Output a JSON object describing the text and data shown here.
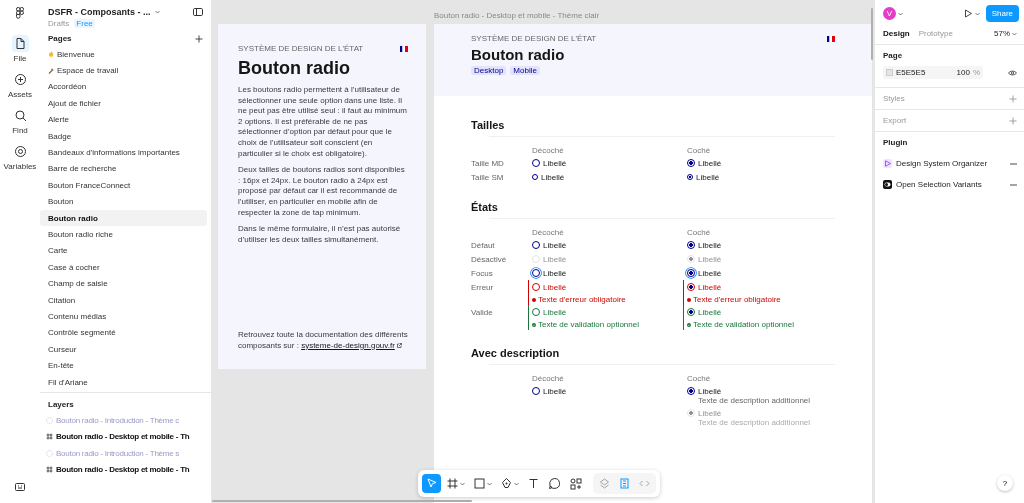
{
  "rail": {
    "items": [
      {
        "label": "File",
        "kind": "file",
        "selected": true
      },
      {
        "label": "Assets",
        "kind": "assets",
        "selected": false
      },
      {
        "label": "Find",
        "kind": "find",
        "selected": false
      },
      {
        "label": "Variables",
        "kind": "variables",
        "selected": false
      }
    ]
  },
  "file": {
    "name": "DSFR - Composants - ...",
    "location": "Drafts",
    "plan": "Free"
  },
  "pages": {
    "title": "Pages",
    "items": [
      {
        "label": "Bienvenue",
        "kind": "hand",
        "selected": false
      },
      {
        "label": "Espace de travail",
        "kind": "hammer",
        "selected": false
      },
      {
        "label": "Accordéon",
        "kind": "plain",
        "selected": false
      },
      {
        "label": "Ajout de fichier",
        "kind": "plain",
        "selected": false
      },
      {
        "label": "Alerte",
        "kind": "plain",
        "selected": false
      },
      {
        "label": "Badge",
        "kind": "plain",
        "selected": false
      },
      {
        "label": "Bandeaux d'informations importantes",
        "kind": "plain",
        "selected": false
      },
      {
        "label": "Barre de recherche",
        "kind": "plain",
        "selected": false
      },
      {
        "label": "Bouton FranceConnect",
        "kind": "plain",
        "selected": false
      },
      {
        "label": "Bouton",
        "kind": "plain",
        "selected": false
      },
      {
        "label": "Bouton radio",
        "kind": "plain",
        "selected": true
      },
      {
        "label": "Bouton radio riche",
        "kind": "plain",
        "selected": false
      },
      {
        "label": "Carte",
        "kind": "plain",
        "selected": false
      },
      {
        "label": "Case à cocher",
        "kind": "plain",
        "selected": false
      },
      {
        "label": "Champ de saisie",
        "kind": "plain",
        "selected": false
      },
      {
        "label": "Citation",
        "kind": "plain",
        "selected": false
      },
      {
        "label": "Contenu médias",
        "kind": "plain",
        "selected": false
      },
      {
        "label": "Contrôle segmenté",
        "kind": "plain",
        "selected": false
      },
      {
        "label": "Curseur",
        "kind": "plain",
        "selected": false
      },
      {
        "label": "En-tête",
        "kind": "plain",
        "selected": false
      },
      {
        "label": "Fil d'Ariane",
        "kind": "plain",
        "selected": false
      }
    ]
  },
  "layers": {
    "title": "Layers",
    "items": [
      {
        "label": "Bouton radio - Introduction - Thème c",
        "kind": "section"
      },
      {
        "label": "Bouton radio - Desktop et mobile - Th",
        "kind": "frame"
      },
      {
        "label": "Bouton radio - Introduction - Thème s",
        "kind": "section"
      },
      {
        "label": "Bouton radio - Desktop et mobile - Th",
        "kind": "frame"
      }
    ]
  },
  "canvas": {
    "intro_frame": {
      "eyebrow": "SYSTÈME DE DESIGN DE L'ÉTAT",
      "heading": "Bouton radio",
      "paragraphs": [
        "Les boutons radio permettent à l’utilisateur de sélectionner une seule option dans une liste. Il ne peut pas être utilisé seul : il faut au minimum 2 options. Il est préférable de ne pas sélectionner d’option par défaut pour que le choix de l’utilisateur soit conscient (en particulier si le choix est obligatoire).",
        "Deux tailles de boutons radios sont disponibles : 16px et 24px. Le bouton radio à 24px est proposé par défaut car il est recommandé de l’utiliser, en particulier en mobile afin de respecter la zone de tap minimum.",
        "Dans le même formulaire, il n’est pas autorisé d’utiliser les deux tailles simultanément."
      ],
      "footer": "Retrouvez toute la documentation des différents composants sur : ",
      "footer_link": "systeme-de-design.gouv.fr"
    },
    "doc_frame": {
      "title": "Bouton radio - Desktop et mobile - Thème clair",
      "eyebrow": "SYSTÈME DE DESIGN DE L'ÉTAT",
      "heading": "Bouton radio",
      "tags": [
        "Desktop",
        "Mobile"
      ],
      "sections": [
        {
          "title": "Tailles",
          "columns": [
            "Décoché",
            "Coché"
          ],
          "rows": [
            {
              "label": "Taille MD",
              "small": false,
              "cells": [
                {
                  "label": "Libellé",
                  "checked": false,
                  "kind": "default"
                },
                {
                  "label": "Libellé",
                  "checked": true,
                  "kind": "default"
                }
              ]
            },
            {
              "label": "Taille SM",
              "small": true,
              "cells": [
                {
                  "label": "Libellé",
                  "checked": false,
                  "kind": "default"
                },
                {
                  "label": "Libellé",
                  "checked": true,
                  "kind": "default"
                }
              ]
            }
          ]
        },
        {
          "title": "États",
          "columns": [
            "Décoché",
            "Coché"
          ],
          "rows": [
            {
              "label": "Défaut",
              "cells": [
                {
                  "label": "Libellé",
                  "checked": false,
                  "kind": "default"
                },
                {
                  "label": "Libellé",
                  "checked": true,
                  "kind": "default"
                }
              ]
            },
            {
              "label": "Désactivé",
              "cells": [
                {
                  "label": "Libellé",
                  "checked": false,
                  "kind": "disabled"
                },
                {
                  "label": "Libellé",
                  "checked": true,
                  "kind": "disabled"
                }
              ]
            },
            {
              "label": "Focus",
              "cells": [
                {
                  "label": "Libellé",
                  "checked": false,
                  "kind": "focus"
                },
                {
                  "label": "Libellé",
                  "checked": true,
                  "kind": "focus"
                }
              ]
            },
            {
              "label": "Erreur",
              "cells": [
                {
                  "label": "Libellé",
                  "checked": false,
                  "kind": "error",
                  "message": "Texte d'erreur obligatoire"
                },
                {
                  "label": "Libellé",
                  "checked": true,
                  "kind": "error",
                  "message": "Texte d'erreur obligatoire"
                }
              ]
            },
            {
              "label": "Valide",
              "cells": [
                {
                  "label": "Libellé",
                  "checked": false,
                  "kind": "valid",
                  "message": "Texte de validation optionnel"
                },
                {
                  "label": "Libellé",
                  "checked": true,
                  "kind": "valid",
                  "message": "Texte de validation optionnel"
                }
              ]
            }
          ]
        },
        {
          "title": "Avec description",
          "columns": [
            "Décoché",
            "Coché"
          ],
          "rows": [
            {
              "cells": [
                {
                  "label": "Libellé",
                  "checked": false,
                  "kind": "default"
                },
                {
                  "label": "Libellé",
                  "checked": true,
                  "kind": "default",
                  "description": "Texte de description additionnel"
                }
              ]
            },
            {
              "cells": [
                null,
                {
                  "label": "Libellé",
                  "checked": true,
                  "kind": "disabled",
                  "description": "Texte de description additionnel"
                }
              ]
            }
          ]
        }
      ]
    }
  },
  "toolbar": {
    "tools": [
      {
        "kind": "move",
        "selected": true
      },
      {
        "kind": "frame",
        "selected": false
      },
      {
        "kind": "shape",
        "selected": false
      },
      {
        "kind": "pen",
        "selected": false
      },
      {
        "kind": "text",
        "selected": false
      },
      {
        "kind": "comment",
        "selected": false
      },
      {
        "kind": "actions",
        "selected": false
      },
      {
        "kind": "mask",
        "selected": false
      },
      {
        "kind": "dev",
        "selected": false
      },
      {
        "kind": "code",
        "selected": false
      }
    ]
  },
  "properties": {
    "avatar": "V",
    "share": "Share",
    "tabs": [
      {
        "label": "Design",
        "selected": true
      },
      {
        "label": "Prototype",
        "selected": false
      }
    ],
    "zoom": "57%",
    "page": {
      "title": "Page",
      "color": "E5E5E5",
      "opacity": "100",
      "unit": "%"
    },
    "styles": "Styles",
    "export": "Export",
    "plugin": {
      "title": "Plugin",
      "items": [
        {
          "name": "Design System Organizer",
          "kind": "organizer"
        },
        {
          "name": "Open Selection Variants",
          "kind": "variants"
        }
      ]
    }
  },
  "help": "?"
}
